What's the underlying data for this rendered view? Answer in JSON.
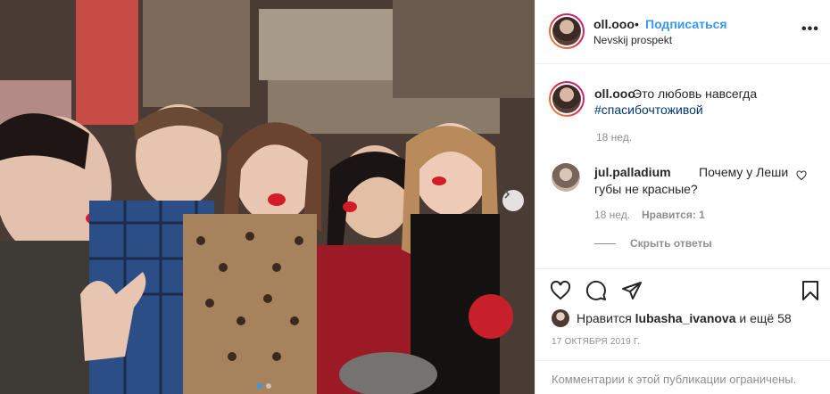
{
  "header": {
    "username": "oll.ooo",
    "separator": "•",
    "follow_label": "Подписаться",
    "location": "Nevskij prospekt",
    "more_label": "•••"
  },
  "caption": {
    "username": "oll.ooo",
    "text": "Это любовь навсегда",
    "hashtag": "#спасибочтоживой",
    "time": "18 нед."
  },
  "comment": {
    "username": "jul.palladium",
    "text_line1": "Почему у Леши",
    "text_line2": "губы не красные?",
    "time": "18 нед.",
    "likes": "Нравится: 1",
    "hide_replies": "Скрыть ответы"
  },
  "likes": {
    "prefix": "Нравится",
    "user": "lubasha_ivanova",
    "suffix": "и ещё 58"
  },
  "date": "17 ОКТЯБРЯ 2019 Г.",
  "restricted": "Комментарии к этой публикации ограничены.",
  "carousel": {
    "slides": 2,
    "active": 1
  },
  "colors": {
    "accent": "#3897f0",
    "text": "#262626",
    "muted": "#8e8e8e",
    "border": "#efefef"
  },
  "icons": [
    "heart-icon",
    "comment-icon",
    "share-icon",
    "bookmark-icon",
    "chevron-right-icon",
    "more-icon"
  ]
}
